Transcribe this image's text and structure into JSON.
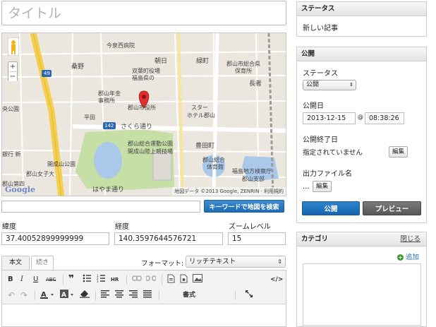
{
  "title": {
    "placeholder": "タイトル"
  },
  "map": {
    "labels": {
      "imaizumi": "今泉西病院",
      "kuwano": "桑野",
      "asahi": "朝日",
      "midoricho": "緑町",
      "futaba": "双葉町役場",
      "fukushima_office": "福島県の",
      "prefecture_hall": "郡山市総合県",
      "hoikusho": "保育所",
      "koriyama_tax": "郡山年金",
      "jimusho": "事務所",
      "cityhall": "郡山市役所",
      "star_hotel": "スター",
      "hotel_koriyama": "ホテル郡山",
      "hirata": "平田",
      "sakura_dori": "さくら通り",
      "sakura_num": "142",
      "route49": "49",
      "chuo_park": "央公園",
      "sports_park": "郡山総合運動公園",
      "kaisei_park": "開成山陸上競技場",
      "toyotacho": "豊田町",
      "nagaya": "長者",
      "fukushima_bank": "銀行 新",
      "kaisei_yama": "開成山公園",
      "joshi_dai": "郡山女子大",
      "general_gym": "郡山総合",
      "gym": "体育館",
      "fukushima_hq": "福島地方検察庁",
      "koriyama_branch": "郡山支部",
      "hayama_dori": "はやま通り",
      "koriyama_fourth": "郡山第四",
      "gg": "Google"
    },
    "attribution": "地図データ ©2013 Google, ZENRIN · 利用規約",
    "zoom_in": "+",
    "zoom_out": "−"
  },
  "keyword": {
    "value": "",
    "button_label": "キーワードで地図を検索"
  },
  "coords": {
    "lat_label": "緯度",
    "lat_value": "37.40052899999999",
    "lng_label": "経度",
    "lng_value": "140.3597644576721",
    "zoom_label": "ズームレベル",
    "zoom_value": "15"
  },
  "editor": {
    "tab_main": "本文",
    "tab_more": "続き",
    "format_label": "フォーマット:",
    "format_value": "リッチテキスト",
    "style_label": "書式",
    "tools": {
      "bold": "B",
      "italic": "I",
      "underline": "U",
      "strike": "ABC",
      "quote": "❞",
      "hr": "HR",
      "source": "</>"
    }
  },
  "status_panel": {
    "heading": "ステータス",
    "value": "新しい記事"
  },
  "publish_panel": {
    "heading": "公開",
    "status_label": "ステータス",
    "status_value": "公開",
    "date_label": "公開日",
    "date_value": "2013-12-15",
    "at_symbol": "@",
    "time_value": "08:38:26",
    "end_label": "公開終了日",
    "end_value": "指定されていません",
    "edit_label": "編集",
    "output_label": "出力ファイル名",
    "output_value": "...",
    "edit_label_2": "編集",
    "publish_button": "公開",
    "preview_button": "プレビュー"
  },
  "category_panel": {
    "heading": "カテゴリ",
    "close_label": "閉じる",
    "add_icon": "+",
    "add_label": "追加"
  },
  "colors": {
    "accent": "#1f6cb6",
    "preview": "#5f5f5f",
    "green": "#3a9b2b"
  }
}
